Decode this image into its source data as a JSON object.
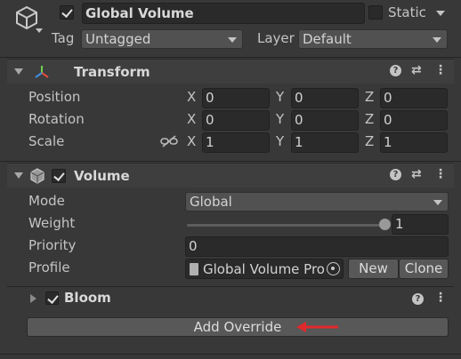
{
  "header": {
    "object_active": true,
    "object_name": "Global Volume",
    "static_label": "Static",
    "static_checked": false,
    "tag_label": "Tag",
    "tag_value": "Untagged",
    "layer_label": "Layer",
    "layer_value": "Default"
  },
  "transform": {
    "title": "Transform",
    "rows": [
      {
        "label": "Position",
        "x": "0",
        "y": "0",
        "z": "0"
      },
      {
        "label": "Rotation",
        "x": "0",
        "y": "0",
        "z": "0"
      },
      {
        "label": "Scale",
        "x": "1",
        "y": "1",
        "z": "1"
      }
    ],
    "axis_x": "X",
    "axis_y": "Y",
    "axis_z": "Z"
  },
  "volume": {
    "title": "Volume",
    "enabled": true,
    "mode_label": "Mode",
    "mode_value": "Global",
    "weight_label": "Weight",
    "weight_value": "1",
    "weight_fraction": 1.0,
    "priority_label": "Priority",
    "priority_value": "0",
    "profile_label": "Profile",
    "profile_value": "Global Volume Pro",
    "new_button": "New",
    "clone_button": "Clone"
  },
  "bloom": {
    "title": "Bloom",
    "enabled": true
  },
  "add_override_button": "Add Override",
  "colors": {
    "background": "#383838",
    "field": "#2a2a2a",
    "arrow": "#e0292b"
  }
}
